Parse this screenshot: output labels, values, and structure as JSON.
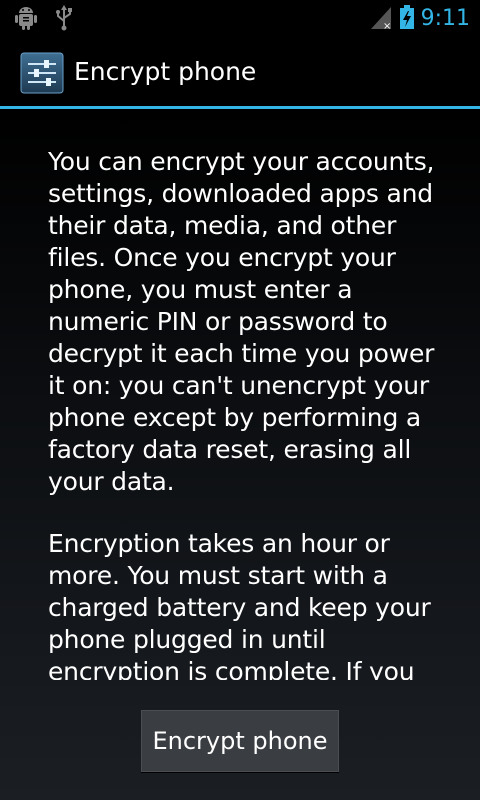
{
  "status_bar": {
    "time": "9:11",
    "icons": {
      "debug": "android-debug-icon",
      "usb": "usb-icon",
      "signal": "signal-no-service-icon",
      "battery": "battery-charging-icon"
    },
    "accent_color": "#33b5e5"
  },
  "action_bar": {
    "title": "Encrypt phone",
    "icon": "settings-sliders-icon"
  },
  "content": {
    "paragraphs": [
      "You can encrypt your accounts, settings, downloaded apps and their data, media, and other files. Once you encrypt your phone, you must enter a numeric PIN or password to decrypt it each time you power it on: you can't unencrypt your phone except by performing a factory data reset, erasing all your data.",
      "Encryption takes an hour or more. You must start with a charged battery and keep your phone plugged in until encryption is complete. If you"
    ]
  },
  "actions": {
    "encrypt_button_label": "Encrypt phone"
  }
}
